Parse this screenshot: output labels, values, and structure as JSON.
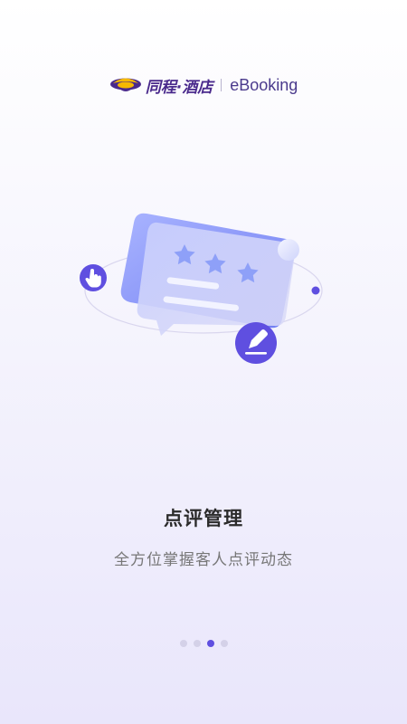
{
  "brand": {
    "logo_icon": "tongcheng-hotel-logo-icon",
    "name": "同程·酒店",
    "product": "eBooking",
    "colors": {
      "brand_purple": "#4a2a8c",
      "logo_yellow": "#f5b800"
    }
  },
  "onboarding": {
    "illustration_icons": [
      "review-card-icon",
      "star-icon",
      "pointer-hand-icon",
      "edit-pen-icon"
    ],
    "title": "点评管理",
    "subtitle": "全方位掌握客人点评动态",
    "page_indicator": {
      "total": 4,
      "current": 3
    }
  },
  "colors": {
    "accent": "#5f4fe0",
    "dot_inactive": "#d4d1e8",
    "title_text": "#2b2b2b",
    "subtitle_text": "#777777"
  }
}
